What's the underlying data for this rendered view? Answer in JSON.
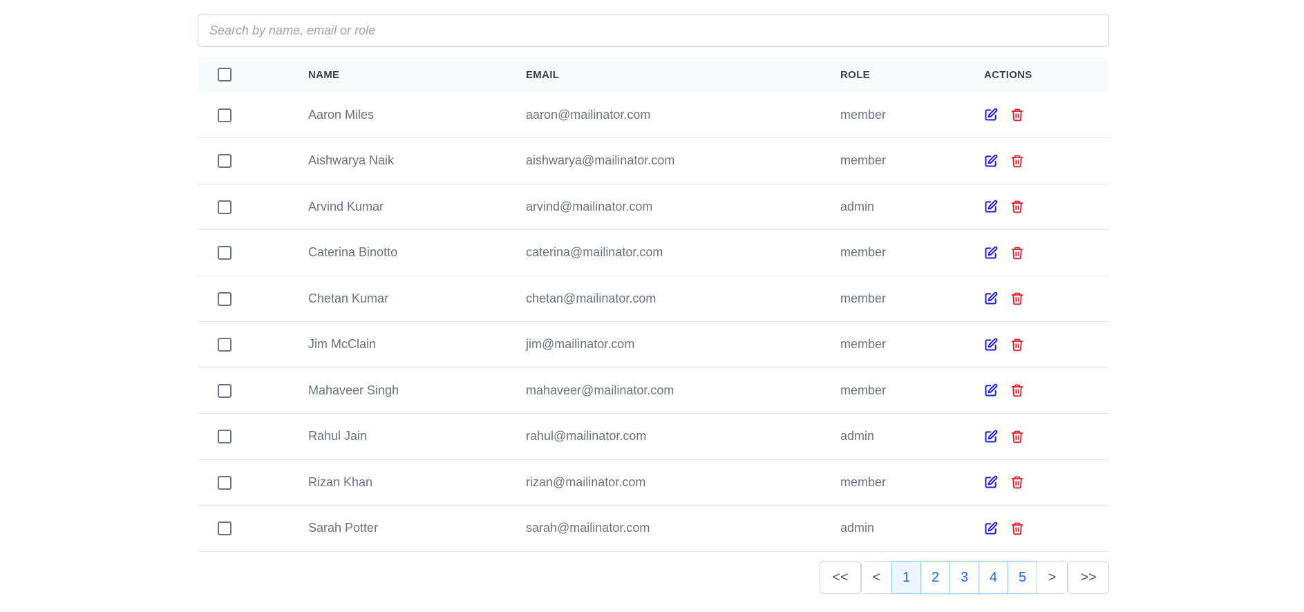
{
  "search": {
    "placeholder": "Search by name, email or role",
    "value": ""
  },
  "table": {
    "headers": {
      "name": "NAME",
      "email": "EMAIL",
      "role": "ROLE",
      "actions": "ACTIONS"
    },
    "rows": [
      {
        "name": "Aaron Miles",
        "email": "aaron@mailinator.com",
        "role": "member"
      },
      {
        "name": "Aishwarya Naik",
        "email": "aishwarya@mailinator.com",
        "role": "member"
      },
      {
        "name": "Arvind Kumar",
        "email": "arvind@mailinator.com",
        "role": "admin"
      },
      {
        "name": "Caterina Binotto",
        "email": "caterina@mailinator.com",
        "role": "member"
      },
      {
        "name": "Chetan Kumar",
        "email": "chetan@mailinator.com",
        "role": "member"
      },
      {
        "name": "Jim McClain",
        "email": "jim@mailinator.com",
        "role": "member"
      },
      {
        "name": "Mahaveer Singh",
        "email": "mahaveer@mailinator.com",
        "role": "member"
      },
      {
        "name": "Rahul Jain",
        "email": "rahul@mailinator.com",
        "role": "admin"
      },
      {
        "name": "Rizan Khan",
        "email": "rizan@mailinator.com",
        "role": "member"
      },
      {
        "name": "Sarah Potter",
        "email": "sarah@mailinator.com",
        "role": "admin"
      }
    ],
    "row_actions": {
      "edit_icon": "edit-icon",
      "delete_icon": "trash-icon"
    }
  },
  "pagination": {
    "first": "<<",
    "prev": "<",
    "pages": [
      "1",
      "2",
      "3",
      "4",
      "5"
    ],
    "current": "1",
    "next": ">",
    "last": ">>"
  },
  "colors": {
    "edit": "#1d1ddb",
    "delete": "#e11d2a",
    "page_link": "#2563eb"
  }
}
